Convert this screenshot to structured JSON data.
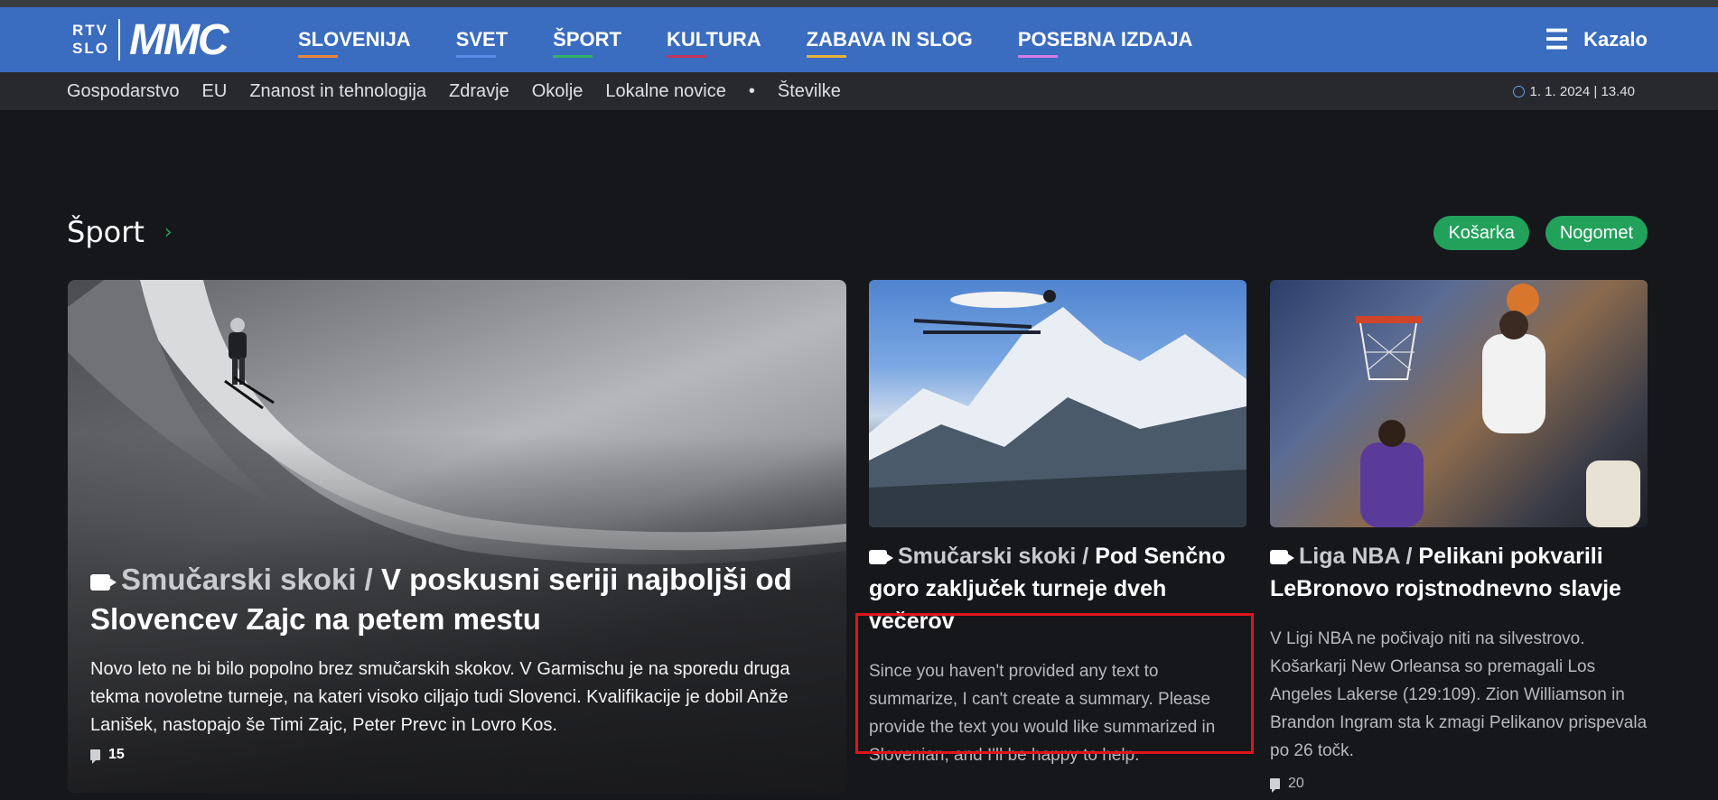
{
  "header": {
    "logo_top": "RTV",
    "logo_bottom": "SLO",
    "logo_brand": "MMC",
    "nav": [
      {
        "label": "SLOVENIJA",
        "color": "#e8873b"
      },
      {
        "label": "SVET",
        "color": "#5b8de8"
      },
      {
        "label": "ŠPORT",
        "color": "#2fb266"
      },
      {
        "label": "KULTURA",
        "color": "#c2365b"
      },
      {
        "label": "ZABAVA IN SLOG",
        "color": "#e6b23a"
      },
      {
        "label": "POSEBNA IZDAJA",
        "color": "#d47be8"
      }
    ],
    "menu_label": "Kazalo"
  },
  "subnav": {
    "items": [
      "Gospodarstvo",
      "EU",
      "Znanost in tehnologija",
      "Zdravje",
      "Okolje",
      "Lokalne novice",
      "•",
      "Številke"
    ],
    "datetime": "1. 1. 2024 | 13.40"
  },
  "section": {
    "title": "Šport",
    "tags": [
      "Košarka",
      "Nogomet"
    ]
  },
  "main_article": {
    "category": "Smučarski skoki /",
    "title": "V poskusni seriji najboljši od Slovencev Zajc na petem mestu",
    "description": "Novo leto ne bi bilo popolno brez smučarskih skokov. V Garmischu je na sporedu druga tekma novoletne turneje, na kateri visoko ciljajo tudi Slovenci. Kvalifikacije je dobil Anže Lanišek, nastopajo še Timi Zajc, Peter Prevc in Lovro Kos.",
    "comments": "15"
  },
  "card1": {
    "category": "Smučarski skoki /",
    "title": "Pod Senčno goro zaključek turneje dveh večerov",
    "description": "Since you haven't provided any text to summarize, I can't create a summary. Please provide the text you would like summarized in Slovenian, and I'll be happy to help."
  },
  "card2": {
    "category": "Liga NBA /",
    "title": "Pelikani pokvarili LeBronovo rojstnodnevno slavje",
    "description": "V Ligi NBA ne počivajo niti na silvestrovo. Košarkarji New Orleansa so premagali Los Angeles Lakerse (129:109). Zion Williamson in Brandon Ingram sta k zmagi Pelikanov prispevala po 26 točk.",
    "comments": "20"
  }
}
